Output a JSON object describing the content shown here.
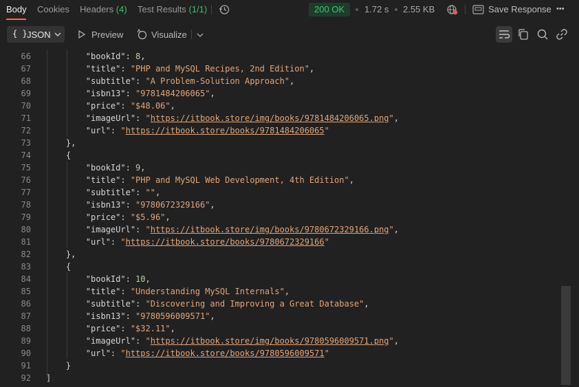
{
  "tabs": [
    {
      "label": "Body",
      "count": ""
    },
    {
      "label": "Cookies",
      "count": ""
    },
    {
      "label": "Headers",
      "count": "(4)"
    },
    {
      "label": "Test Results",
      "count": "(1/1)"
    }
  ],
  "status": {
    "code": "200 OK",
    "time": "1.72 s",
    "size": "2.55 KB",
    "save_label": "Save Response",
    "more_label": "•••"
  },
  "toolbar": {
    "format_label": "JSON",
    "format_brace": "{ }",
    "preview_label": "Preview",
    "visualize_label": "Visualize"
  },
  "editor": {
    "lines": [
      {
        "n": "66",
        "indent": 8,
        "kind": "kv",
        "key": "bookId",
        "value": "8",
        "vtype": "num",
        "comma": true
      },
      {
        "n": "67",
        "indent": 8,
        "kind": "kv",
        "key": "title",
        "value": "PHP and MySQL Recipes, 2nd Edition",
        "vtype": "str",
        "comma": true
      },
      {
        "n": "68",
        "indent": 8,
        "kind": "kv",
        "key": "subtitle",
        "value": "A Problem-Solution Approach",
        "vtype": "str",
        "comma": true
      },
      {
        "n": "69",
        "indent": 8,
        "kind": "kv",
        "key": "isbn13",
        "value": "9781484206065",
        "vtype": "str",
        "comma": true
      },
      {
        "n": "70",
        "indent": 8,
        "kind": "kv",
        "key": "price",
        "value": "$48.06",
        "vtype": "str",
        "comma": true
      },
      {
        "n": "71",
        "indent": 8,
        "kind": "kv",
        "key": "imageUrl",
        "value": "https://itbook.store/img/books/9781484206065.png",
        "vtype": "url",
        "comma": true
      },
      {
        "n": "72",
        "indent": 8,
        "kind": "kv",
        "key": "url",
        "value": "https://itbook.store/books/9781484206065",
        "vtype": "url",
        "comma": false
      },
      {
        "n": "73",
        "indent": 4,
        "kind": "punct",
        "text": "},"
      },
      {
        "n": "74",
        "indent": 4,
        "kind": "punct",
        "text": "{"
      },
      {
        "n": "75",
        "indent": 8,
        "kind": "kv",
        "key": "bookId",
        "value": "9",
        "vtype": "num",
        "comma": true
      },
      {
        "n": "76",
        "indent": 8,
        "kind": "kv",
        "key": "title",
        "value": "PHP and MySQL Web Development, 4th Edition",
        "vtype": "str",
        "comma": true
      },
      {
        "n": "77",
        "indent": 8,
        "kind": "kv",
        "key": "subtitle",
        "value": "",
        "vtype": "str",
        "comma": true
      },
      {
        "n": "78",
        "indent": 8,
        "kind": "kv",
        "key": "isbn13",
        "value": "9780672329166",
        "vtype": "str",
        "comma": true
      },
      {
        "n": "79",
        "indent": 8,
        "kind": "kv",
        "key": "price",
        "value": "$5.96",
        "vtype": "str",
        "comma": true
      },
      {
        "n": "80",
        "indent": 8,
        "kind": "kv",
        "key": "imageUrl",
        "value": "https://itbook.store/img/books/9780672329166.png",
        "vtype": "url",
        "comma": true
      },
      {
        "n": "81",
        "indent": 8,
        "kind": "kv",
        "key": "url",
        "value": "https://itbook.store/books/9780672329166",
        "vtype": "url",
        "comma": false
      },
      {
        "n": "82",
        "indent": 4,
        "kind": "punct",
        "text": "},"
      },
      {
        "n": "83",
        "indent": 4,
        "kind": "punct",
        "text": "{"
      },
      {
        "n": "84",
        "indent": 8,
        "kind": "kv",
        "key": "bookId",
        "value": "10",
        "vtype": "num",
        "comma": true
      },
      {
        "n": "85",
        "indent": 8,
        "kind": "kv",
        "key": "title",
        "value": "Understanding MySQL Internals",
        "vtype": "str",
        "comma": true
      },
      {
        "n": "86",
        "indent": 8,
        "kind": "kv",
        "key": "subtitle",
        "value": "Discovering and Improving a Great Database",
        "vtype": "str",
        "comma": true
      },
      {
        "n": "87",
        "indent": 8,
        "kind": "kv",
        "key": "isbn13",
        "value": "9780596009571",
        "vtype": "str",
        "comma": true
      },
      {
        "n": "88",
        "indent": 8,
        "kind": "kv",
        "key": "price",
        "value": "$32.11",
        "vtype": "str",
        "comma": true
      },
      {
        "n": "89",
        "indent": 8,
        "kind": "kv",
        "key": "imageUrl",
        "value": "https://itbook.store/img/books/9780596009571.png",
        "vtype": "url",
        "comma": true
      },
      {
        "n": "90",
        "indent": 8,
        "kind": "kv",
        "key": "url",
        "value": "https://itbook.store/books/9780596009571",
        "vtype": "url",
        "comma": false
      },
      {
        "n": "91",
        "indent": 4,
        "kind": "punct",
        "text": "}"
      },
      {
        "n": "92",
        "indent": 0,
        "kind": "punct",
        "text": "]"
      }
    ]
  },
  "colors": {
    "accent": "#ff6c37",
    "status_ok": "#3ec46d",
    "string": "#e3a57a",
    "number": "#b5cea8",
    "line_number": "#8a8a8a"
  }
}
